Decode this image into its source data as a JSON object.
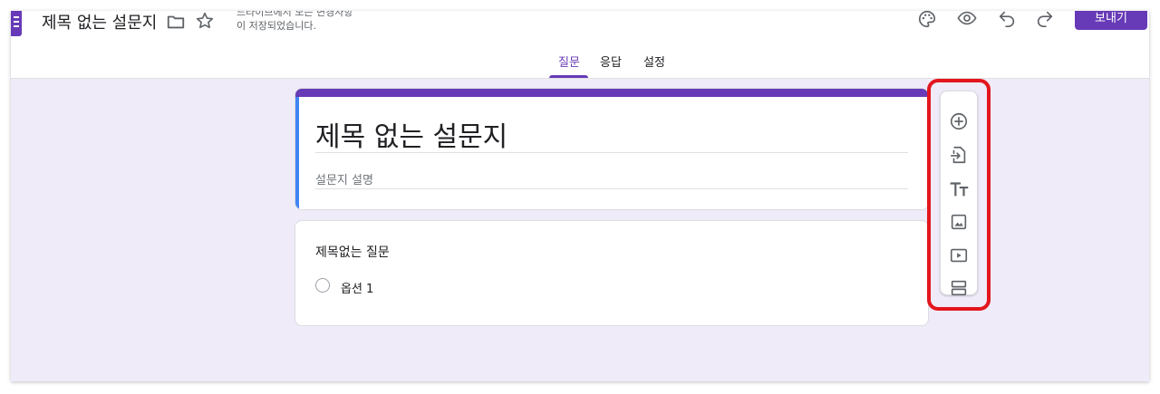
{
  "header": {
    "doc_title": "제목 없는 설문지",
    "save_status_line1": "드라이브에서 모든 변경사항",
    "save_status_line2": "이 저장되었습니다.",
    "send_label": "보내기"
  },
  "tabs": [
    {
      "label": "질문",
      "active": true
    },
    {
      "label": "응답",
      "active": false
    },
    {
      "label": "설정",
      "active": false
    }
  ],
  "form": {
    "title": "제목 없는 설문지",
    "description_placeholder": "설문지 설명"
  },
  "question": {
    "text": "제목없는 질문",
    "options": [
      "옵션 1"
    ]
  },
  "toolbar": {
    "buttons": [
      "add-question-icon",
      "import-questions-icon",
      "add-title-icon",
      "add-image-icon",
      "add-video-icon",
      "add-section-icon"
    ]
  },
  "colors": {
    "accent": "#673ab7",
    "background": "#f0ebf8",
    "highlight": "#e3161e",
    "left_bar": "#4285f4"
  }
}
